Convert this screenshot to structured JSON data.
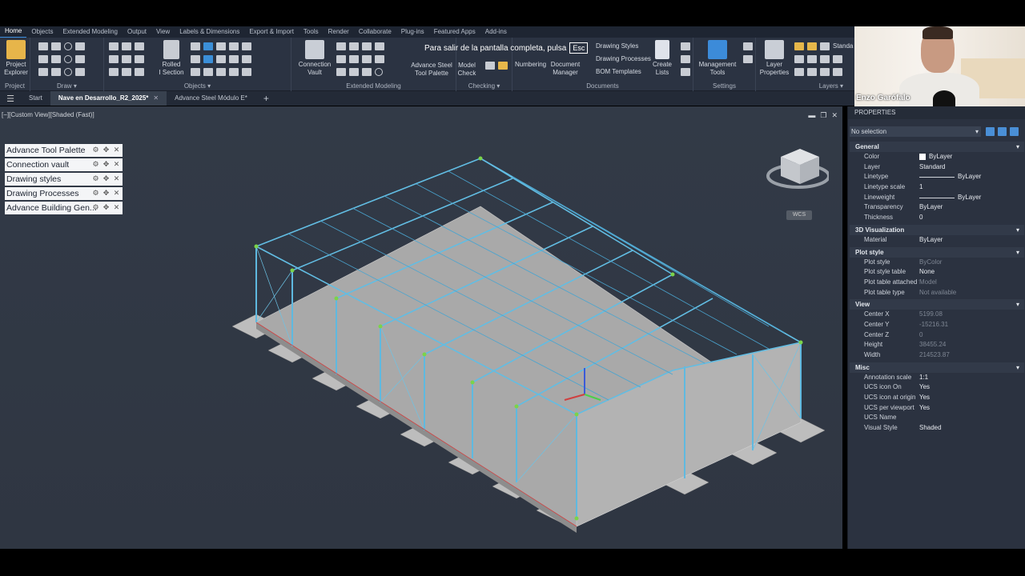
{
  "menu": {
    "tabs": [
      "Home",
      "Objects",
      "Extended Modeling",
      "Output",
      "View",
      "Labels & Dimensions",
      "Export & Import",
      "Tools",
      "Render",
      "Collaborate",
      "Plug-ins",
      "Featured Apps",
      "Add-ins"
    ]
  },
  "ribbon": {
    "project_explorer": "Project\nExplorer",
    "rolled_section": "Rolled\nI Section",
    "connection_vault": "Connection\nVault",
    "advance_steel_tool_palette": "Advance Steel\nTool Palette",
    "model_check": "Model\nCheck",
    "numbering": "Numbering",
    "document_manager": "Document\nManager",
    "drawing_styles": "Drawing Styles",
    "drawing_processes": "Drawing Processes",
    "bom_templates": "BOM Templates",
    "create_lists": "Create\nLists",
    "management_tools": "Management\nTools",
    "layer_properties": "Layer\nProperties",
    "layer_standard": "Standa",
    "groups": {
      "project": "Project",
      "draw": "Draw",
      "objects": "Objects",
      "extended_modeling": "Extended Modeling",
      "checking": "Checking",
      "documents": "Documents",
      "settings": "Settings",
      "layers": "Layers"
    }
  },
  "fullscreen_toast": {
    "text": "Para salir de la pantalla completa, pulsa",
    "key": "Esc"
  },
  "filetabs": {
    "start": "Start",
    "active": "Nave en Desarrollo_R2_2025*",
    "other": "Advance Steel Módulo E*"
  },
  "viewport": {
    "label": "[−][Custom View][Shaded (Fast)]",
    "wcs": "WCS",
    "palettes": [
      "Advance Tool Palette",
      "Connection vault",
      "Drawing styles",
      "Drawing Processes",
      "Advance Building Gen..."
    ]
  },
  "properties": {
    "title": "PROPERTIES",
    "selection": "No selection",
    "sections": [
      {
        "name": "General",
        "rows": [
          {
            "k": "Color",
            "v": "ByLayer",
            "t": "swatch"
          },
          {
            "k": "Layer",
            "v": "Standard"
          },
          {
            "k": "Linetype",
            "v": "ByLayer",
            "t": "line"
          },
          {
            "k": "Linetype scale",
            "v": "1"
          },
          {
            "k": "Lineweight",
            "v": "ByLayer",
            "t": "line"
          },
          {
            "k": "Transparency",
            "v": "ByLayer"
          },
          {
            "k": "Thickness",
            "v": "0"
          }
        ]
      },
      {
        "name": "3D Visualization",
        "rows": [
          {
            "k": "Material",
            "v": "ByLayer"
          }
        ]
      },
      {
        "name": "Plot style",
        "rows": [
          {
            "k": "Plot style",
            "v": "ByColor",
            "t": "dim"
          },
          {
            "k": "Plot style table",
            "v": "None"
          },
          {
            "k": "Plot table attached to",
            "v": "Model",
            "t": "dim"
          },
          {
            "k": "Plot table type",
            "v": "Not available",
            "t": "dim"
          }
        ]
      },
      {
        "name": "View",
        "rows": [
          {
            "k": "Center X",
            "v": "5199.08",
            "t": "dim"
          },
          {
            "k": "Center Y",
            "v": "-15216.31",
            "t": "dim"
          },
          {
            "k": "Center Z",
            "v": "0",
            "t": "dim"
          },
          {
            "k": "Height",
            "v": "38455.24",
            "t": "dim"
          },
          {
            "k": "Width",
            "v": "214523.87",
            "t": "dim"
          }
        ]
      },
      {
        "name": "Misc",
        "rows": [
          {
            "k": "Annotation scale",
            "v": "1:1"
          },
          {
            "k": "UCS icon On",
            "v": "Yes"
          },
          {
            "k": "UCS icon at origin",
            "v": "Yes"
          },
          {
            "k": "UCS per viewport",
            "v": "Yes"
          },
          {
            "k": "UCS Name",
            "v": ""
          },
          {
            "k": "Visual Style",
            "v": "Shaded"
          }
        ]
      }
    ]
  },
  "webcam": {
    "name": "Enzo Garófalo"
  }
}
